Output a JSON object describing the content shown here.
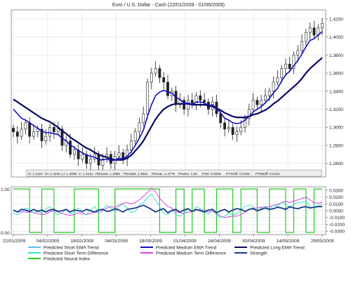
{
  "chart_data": [
    {
      "type": "candlestick",
      "title": "Euro / U.S. Dollar -  Cash      (22/01/2009 - 01/06/2009)",
      "ylim": [
        1.245,
        1.43
      ],
      "yticks": [
        1.26,
        1.28,
        1.3,
        1.32,
        1.34,
        1.36,
        1.38,
        1.4,
        1.42
      ],
      "ytick_labels": [
        "1.2600",
        "1.2800",
        "1.3000",
        "1.3200",
        "1.3400",
        "1.3600",
        "1.3800",
        "1.4000",
        "1.4200"
      ],
      "grid": true,
      "close": [
        1.295,
        1.29,
        1.298,
        1.305,
        1.29,
        1.295,
        1.298,
        1.285,
        1.29,
        1.3,
        1.295,
        1.298,
        1.28,
        1.285,
        1.27,
        1.275,
        1.265,
        1.27,
        1.26,
        1.265,
        1.27,
        1.258,
        1.265,
        1.27,
        1.26,
        1.268,
        1.272,
        1.265,
        1.275,
        1.285,
        1.295,
        1.305,
        1.315,
        1.35,
        1.36,
        1.365,
        1.355,
        1.35,
        1.335,
        1.34,
        1.325,
        1.33,
        1.32,
        1.33,
        1.325,
        1.335,
        1.33,
        1.328,
        1.32,
        1.328,
        1.315,
        1.305,
        1.298,
        1.3,
        1.292,
        1.295,
        1.3,
        1.31,
        1.32,
        1.33,
        1.325,
        1.33,
        1.335,
        1.34,
        1.35,
        1.355,
        1.365,
        1.37,
        1.365,
        1.38,
        1.385,
        1.395,
        1.405,
        1.41,
        1.402,
        1.41,
        1.415
      ],
      "ema_short": [
        1.32,
        1.315,
        1.31,
        1.308,
        1.305,
        1.302,
        1.299,
        1.296,
        1.294,
        1.294,
        1.293,
        1.292,
        1.288,
        1.285,
        1.28,
        1.278,
        1.274,
        1.272,
        1.269,
        1.268,
        1.267,
        1.264,
        1.264,
        1.265,
        1.263,
        1.264,
        1.266,
        1.265,
        1.268,
        1.273,
        1.28,
        1.288,
        1.297,
        1.312,
        1.325,
        1.335,
        1.339,
        1.341,
        1.339,
        1.338,
        1.333,
        1.331,
        1.327,
        1.327,
        1.325,
        1.328,
        1.328,
        1.327,
        1.324,
        1.325,
        1.321,
        1.316,
        1.31,
        1.308,
        1.305,
        1.304,
        1.305,
        1.308,
        1.312,
        1.317,
        1.32,
        1.323,
        1.327,
        1.332,
        1.338,
        1.343,
        1.351,
        1.358,
        1.362,
        1.368,
        1.374,
        1.381,
        1.389,
        1.396,
        1.398,
        1.402,
        1.406
      ],
      "ema_long": [
        1.331,
        1.328,
        1.325,
        1.322,
        1.319,
        1.316,
        1.313,
        1.31,
        1.308,
        1.306,
        1.303,
        1.3,
        1.296,
        1.293,
        1.289,
        1.286,
        1.283,
        1.28,
        1.277,
        1.275,
        1.272,
        1.27,
        1.268,
        1.267,
        1.265,
        1.264,
        1.264,
        1.264,
        1.266,
        1.269,
        1.274,
        1.279,
        1.285,
        1.293,
        1.301,
        1.309,
        1.315,
        1.32,
        1.323,
        1.325,
        1.326,
        1.326,
        1.326,
        1.326,
        1.325,
        1.325,
        1.325,
        1.325,
        1.324,
        1.323,
        1.321,
        1.319,
        1.316,
        1.314,
        1.312,
        1.311,
        1.311,
        1.311,
        1.312,
        1.314,
        1.315,
        1.317,
        1.319,
        1.322,
        1.326,
        1.329,
        1.333,
        1.337,
        1.341,
        1.345,
        1.349,
        1.354,
        1.36,
        1.365,
        1.369,
        1.373,
        1.377
      ],
      "ohlc_readout": {
        "items": [
          "O: 1.4157",
          "Hi: 1.4246",
          "Li: 1.4098",
          "C: 1.4151",
          "PEmaSt: 1.4085",
          "PEmaM: 1.3963",
          "PEmaL: 1.3779",
          "PIndex: 1.00",
          "PStr: 0.0059",
          "PTSDiff: 0.0108",
          "PTMDiff: 0.0119"
        ]
      }
    },
    {
      "type": "line",
      "ylim_left": [
        0,
        1
      ],
      "left_labels": [
        "1.00",
        "0.00"
      ],
      "ylim_right": [
        -0.035,
        0.035
      ],
      "yticks_right": [
        0.03,
        0.02,
        0.01,
        0.0,
        -0.01,
        -0.02,
        -0.03
      ],
      "ytick_labels_right": [
        "0.0300",
        "0.0200",
        "0.0100",
        "0.0000",
        "-0.0100",
        "-0.0200",
        "-0.0300"
      ],
      "x_tick_labels": [
        "22/01/2009",
        "04/02/2009",
        "18/02/2009",
        "04/03/2009",
        "18/03/2009",
        "01/04/2009",
        "16/04/2009",
        "30/04/2009",
        "14/05/2009",
        "29/05/2009"
      ],
      "neural_index": [
        1,
        1,
        1,
        1,
        0,
        0,
        0,
        1,
        1,
        1,
        0,
        0,
        0,
        0,
        0,
        1,
        1,
        1,
        1,
        1,
        1,
        0,
        0,
        0,
        0,
        1,
        1,
        1,
        1,
        1,
        1,
        1,
        1,
        1,
        1,
        1,
        0,
        0,
        0,
        0,
        1,
        1,
        0,
        0,
        1,
        1,
        1,
        0,
        0,
        0,
        1,
        1,
        1,
        1,
        0,
        0,
        1,
        1,
        1,
        1,
        0,
        0,
        0,
        1,
        1,
        1,
        1,
        0,
        0,
        1,
        1,
        1,
        0,
        0,
        1,
        1,
        1
      ],
      "short_term_diff": [
        -0.003,
        -0.006,
        -0.002,
        0.004,
        0.002,
        -0.004,
        0.001,
        -0.005,
        0.003,
        0.006,
        -0.002,
        -0.006,
        -0.003,
        0.002,
        -0.005,
        -0.003,
        0.004,
        -0.002,
        -0.006,
        0.001,
        0.006,
        -0.004,
        0.002,
        0.008,
        0.004,
        -0.002,
        0.006,
        0.01,
        0.004,
        -0.003,
        -0.001,
        0.008,
        0.012,
        0.02,
        0.024,
        0.016,
        0.006,
        -0.004,
        -0.006,
        0.002,
        -0.006,
        -0.008,
        -0.004,
        0.003,
        -0.002,
        0.006,
        0.003,
        -0.002,
        -0.005,
        0.002,
        -0.006,
        -0.01,
        -0.008,
        -0.003,
        -0.006,
        -0.005,
        0.002,
        0.006,
        0.008,
        0.006,
        -0.002,
        0.004,
        0.006,
        0.002,
        0.008,
        0.006,
        0.012,
        0.01,
        0.004,
        0.01,
        0.012,
        0.012,
        0.014,
        0.006,
        0.004,
        0.008,
        0.009
      ],
      "medium_term_diff": [
        0.0,
        -0.001,
        -0.002,
        -0.002,
        -0.002,
        -0.003,
        -0.004,
        -0.006,
        -0.005,
        -0.002,
        0.0,
        -0.002,
        -0.004,
        -0.006,
        -0.007,
        -0.006,
        -0.003,
        -0.004,
        -0.006,
        -0.004,
        -0.002,
        -0.003,
        0.0,
        0.004,
        0.006,
        0.005,
        0.008,
        0.011,
        0.012,
        0.01,
        0.012,
        0.016,
        0.021,
        0.027,
        0.033,
        0.028,
        0.018,
        0.012,
        0.006,
        0.004,
        -0.001,
        -0.003,
        -0.004,
        -0.002,
        -0.002,
        0.001,
        0.002,
        0.001,
        -0.002,
        -0.001,
        -0.004,
        -0.008,
        -0.01,
        -0.009,
        -0.008,
        -0.008,
        -0.006,
        -0.002,
        0.002,
        0.004,
        0.004,
        0.005,
        0.006,
        0.006,
        0.008,
        0.009,
        0.012,
        0.014,
        0.012,
        0.014,
        0.016,
        0.018,
        0.02,
        0.016,
        0.012,
        0.011,
        0.012
      ],
      "strength": [
        0.001,
        -0.002,
        0.002,
        0.001,
        -0.001,
        0.002,
        -0.001,
        0.001,
        -0.002,
        0.001,
        0.002,
        -0.001,
        0.0,
        0.002,
        -0.002,
        0.001,
        0.0,
        -0.001,
        0.002,
        0.0,
        -0.002,
        0.001,
        0.002,
        -0.001,
        0.0,
        0.003,
        0.001,
        -0.002,
        0.002,
        0.003,
        0.004,
        0.006,
        0.008,
        0.005,
        0.002,
        -0.002,
        0.001,
        0.003,
        -0.003,
        0.0,
        0.002,
        -0.002,
        0.001,
        0.003,
        -0.001,
        0.002,
        0.0,
        -0.002,
        0.001,
        0.002,
        -0.003,
        0.0,
        0.002,
        -0.002,
        0.001,
        0.003,
        0.002,
        -0.001,
        0.002,
        0.003,
        0.0,
        0.002,
        0.004,
        0.002,
        0.003,
        0.005,
        0.004,
        0.002,
        0.006,
        0.004,
        0.003,
        0.005,
        0.006,
        0.004,
        0.005,
        0.006,
        0.006
      ],
      "series": [
        {
          "name": "Predicted Short EMA Trend",
          "color": "#5fbfea"
        },
        {
          "name": "Predicted Short Term Difference",
          "color": "#40e0d0"
        },
        {
          "name": "Predicted Neural Index",
          "color": "#22cc22"
        },
        {
          "name": "Predicted Medium EMA Trend",
          "color": "#1010c0"
        },
        {
          "name": "Predicted Medium Term Difference",
          "color": "#e040e0"
        },
        {
          "name": "Predicted Long EMA Trend",
          "color": "#0a0a60"
        },
        {
          "name": "Strength",
          "color": "#1a3a8a"
        }
      ]
    }
  ]
}
